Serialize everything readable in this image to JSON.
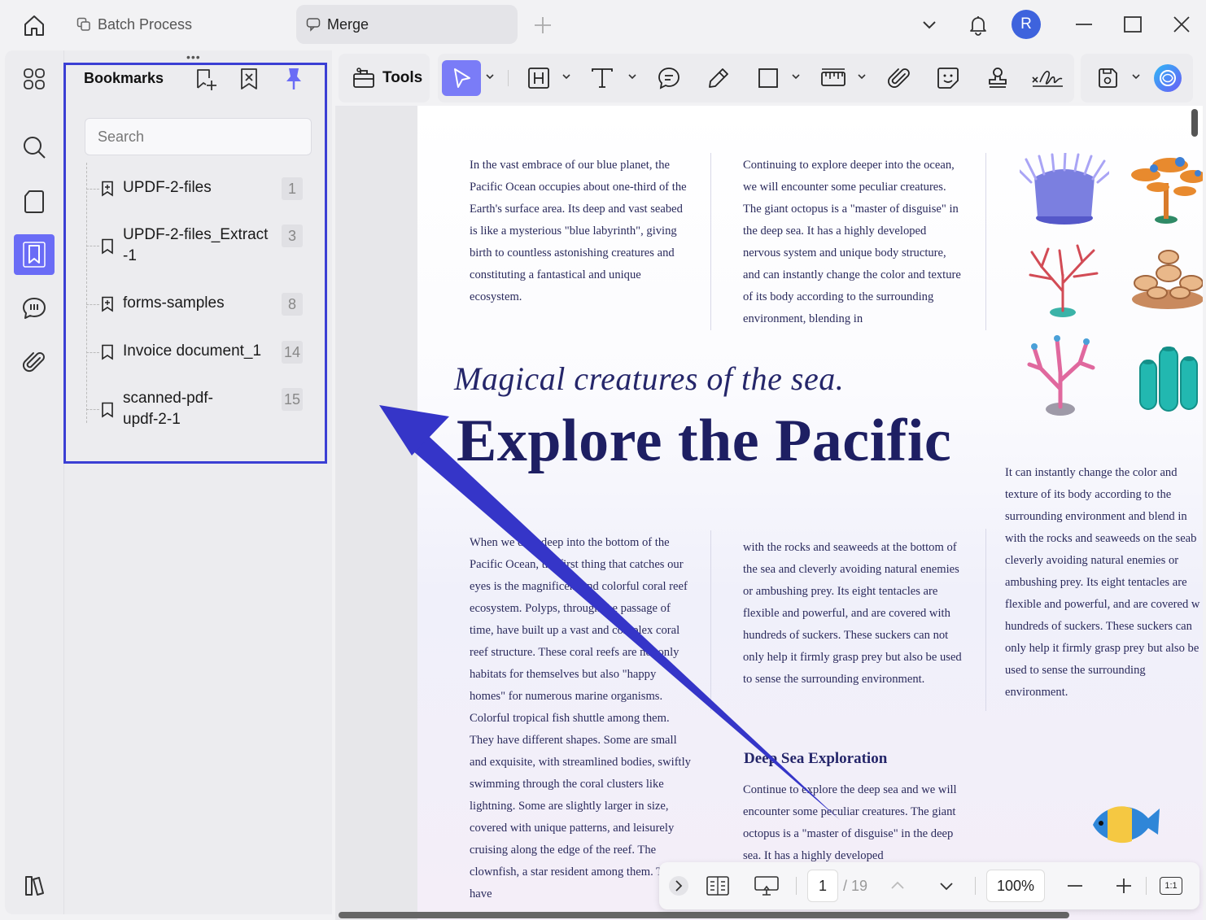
{
  "titlebar": {
    "tabs": [
      {
        "label": "Batch Process",
        "icon": "copy-icon"
      },
      {
        "label": "Merge",
        "icon": "comment-bubble-icon"
      }
    ],
    "avatar_initial": "R"
  },
  "bookmarks": {
    "title": "Bookmarks",
    "search_placeholder": "Search",
    "items": [
      {
        "label": "UPDF-2-files",
        "page": "1"
      },
      {
        "label": "UPDF-2-files_Extract-1",
        "page": "3"
      },
      {
        "label": "forms-samples",
        "page": "8"
      },
      {
        "label": "Invoice document_1",
        "page": "14"
      },
      {
        "label": "scanned-pdf-updf-2-1",
        "page": "15"
      }
    ]
  },
  "toolbar": {
    "tools_label": "Tools"
  },
  "document": {
    "col1_top": "In the vast embrace of our blue planet, the Pacific Ocean occupies about one-third of the Earth's surface area. Its deep and vast seabed is like a mysterious \"blue labyrinth\", giving birth to countless astonishing creatures and constituting a fantastical and unique ecosystem.",
    "col2_top": "Continuing to explore deeper into the ocean, we will encounter some peculiar creatures. The giant octopus is a \"master of disguise\" in the deep sea. It has a highly developed nervous system and unique body structure, and can instantly change the color and texture of its body according to the surrounding environment, blending in",
    "subtitle": "Magical creatures of the sea.",
    "title": "Explore the Pacific",
    "col3_right": "It can instantly change the color and texture of its body according to the surrounding environment and blend in with the rocks and seaweeds on the seab cleverly avoiding natural enemies or ambushing prey. Its eight tentacles are flexible and powerful, and are covered w hundreds of suckers. These suckers can only help it firmly grasp prey but also be used to sense the surrounding environment.",
    "col1_bottom": "When we dive deep into the bottom of the Pacific Ocean, the first thing that catches our eyes is the magnificent and colorful coral reef ecosystem. Polyps, through the passage of time, have built up a vast and complex coral reef structure. These coral reefs are not only habitats for themselves but also \"happy homes\" for numerous marine organisms. Colorful tropical fish shuttle among them. They have different shapes. Some are small and exquisite, with streamlined bodies, swiftly swimming through the coral clusters like lightning. Some are slightly larger in size, covered with unique patterns, and leisurely cruising along the edge of the reef. The clownfish, a star resident among them. They have",
    "col2_bottom": "with the rocks and seaweeds at the bottom of the sea and cleverly avoiding natural enemies or ambushing prey. Its eight tentacles are flexible and powerful, and are covered with hundreds of suckers. These suckers can not only help it firmly grasp prey but also be used to sense the surrounding environment.",
    "heading2": "Deep Sea Exploration",
    "col2_deep": "Continue to explore the deep sea and we will encounter some peculiar creatures. The giant octopus is a \"master of disguise\" in the deep sea. It has a highly developed"
  },
  "navbar": {
    "current_page": "1",
    "total_pages": "/ 19",
    "zoom": "100%",
    "fit_label": "1:1"
  },
  "colors": {
    "accent": "#6a6cf6",
    "highlight_border": "#3b3fd4",
    "arrow": "#3535c8",
    "title_text": "#1e1f63"
  }
}
